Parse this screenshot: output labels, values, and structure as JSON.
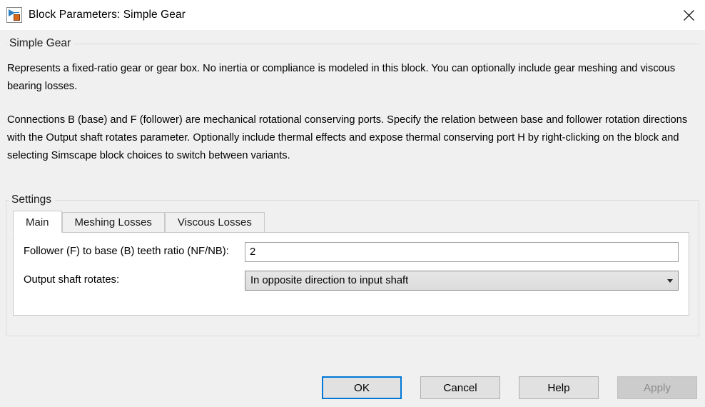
{
  "window": {
    "title": "Block Parameters: Simple Gear",
    "icon": "simulink-block-icon",
    "close_label": "✕"
  },
  "description": {
    "group_label": "Simple Gear",
    "paragraphs": [
      "Represents a fixed-ratio gear or gear box. No inertia or compliance is modeled in this block. You can optionally include gear meshing and viscous bearing losses.",
      "Connections B (base) and F (follower) are mechanical rotational conserving ports. Specify the relation between base and follower rotation directions with the Output shaft rotates parameter. Optionally include thermal effects and expose thermal conserving port H by right-clicking on the block and selecting Simscape block choices to switch between variants."
    ]
  },
  "settings": {
    "group_label": "Settings",
    "tabs": [
      {
        "label": "Main",
        "active": true
      },
      {
        "label": "Meshing Losses",
        "active": false
      },
      {
        "label": "Viscous Losses",
        "active": false
      }
    ],
    "fields": [
      {
        "label": "Follower (F) to base (B) teeth ratio (NF/NB):",
        "type": "text",
        "value": "2",
        "placeholder": ""
      },
      {
        "label": "Output shaft rotates:",
        "type": "select",
        "value": "In opposite direction to input shaft"
      }
    ]
  },
  "buttons": [
    {
      "label": "OK",
      "state": "default"
    },
    {
      "label": "Cancel",
      "state": "normal"
    },
    {
      "label": "Help",
      "state": "normal"
    },
    {
      "label": "Apply",
      "state": "disabled"
    }
  ],
  "colors": {
    "window_background": "#f0f0f0",
    "titlebar_background": "#ffffff",
    "panel_background": "#ffffff",
    "focus_border": "#0078d7",
    "disabled_text": "#8c8c8c"
  }
}
